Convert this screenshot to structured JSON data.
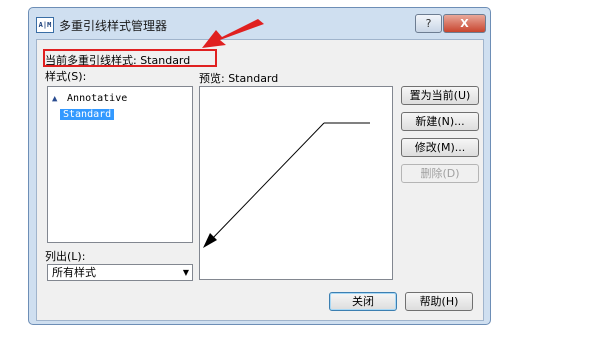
{
  "dialog": {
    "title": "多重引线样式管理器",
    "app_icon_text": "A|M",
    "help_label": "?",
    "close_label": "X"
  },
  "current_style": {
    "label": "当前多重引线样式: Standard"
  },
  "styles_label": "样式(S):",
  "styles": [
    {
      "name": "Annotative",
      "icon": "annotative-triangle-icon"
    },
    {
      "name": "Standard",
      "selected": true
    }
  ],
  "list_label": "列出(L):",
  "list_filter": {
    "value": "所有样式"
  },
  "preview_label": "预览: Standard",
  "buttons": {
    "set_current": "置为当前(U)",
    "new": "新建(N)...",
    "modify": "修改(M)...",
    "delete": "删除(D)",
    "close": "关闭",
    "help": "帮助(H)"
  },
  "colors": {
    "annotation_red": "#e02020",
    "selection": "#3399ff",
    "frame": "#cfdff0"
  }
}
